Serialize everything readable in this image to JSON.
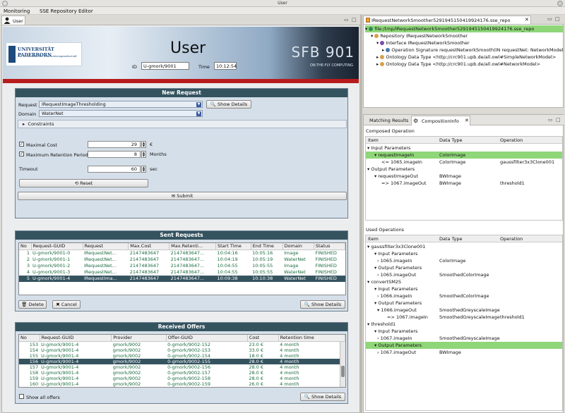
{
  "window": {
    "title": "User"
  },
  "menubar": {
    "items": [
      "Monitoring",
      "SSE Repository Editor"
    ]
  },
  "left_tab": {
    "label": "User"
  },
  "header": {
    "university": "UNIVERSITÄT PADERBORN",
    "university_sub": "Die Universität der Informationsgesellschaft",
    "title": "User",
    "id_label": "ID",
    "id_value": "U-gmork/9001",
    "time_label": "Time",
    "time_value": "10:12:54",
    "sfb": "SFB 901",
    "sfb_sub": "ON-THE-FLY COMPUTING"
  },
  "new_request": {
    "title": "New Request",
    "request_label": "Request",
    "request_value": "IRequestImageThresholding",
    "show_details": "Show Details",
    "domain_label": "Domain",
    "domain_value": "WaterNet",
    "constraints_label": "Constraints",
    "maximal_cost_label": "Maximal Cost",
    "maximal_cost_value": "29",
    "maximal_cost_unit": "€",
    "retention_label": "Maximum Retention Period",
    "retention_value": "8",
    "retention_unit": "Months",
    "timeout_label": "Timeout",
    "timeout_value": "60",
    "timeout_unit": "sec",
    "reset_label": "Reset",
    "submit_label": "Submit"
  },
  "sent_requests": {
    "title": "Sent Requests",
    "columns": [
      "No",
      "Request-GUID",
      "Request",
      "Max.Cost",
      "Max.Retenti...",
      "Start Time",
      "End Time",
      "Domain",
      "Status"
    ],
    "rows": [
      [
        "1",
        "U-gmork/9001-0",
        "IRequestNet...",
        "2147483647",
        "2147483647...",
        "10:04:16",
        "10:05:16",
        "Image",
        "FINISHED"
      ],
      [
        "2",
        "U-gmork/9001-1",
        "IRequestNet...",
        "2147483647",
        "2147483647...",
        "10:04:19",
        "10:05:19",
        "WaterNet",
        "FINISHED"
      ],
      [
        "3",
        "U-gmork/9001-2",
        "IRequestNet...",
        "2147483647",
        "2147483647...",
        "10:04:55",
        "10:05:55",
        "Image",
        "FINISHED"
      ],
      [
        "4",
        "U-gmork/9001-3",
        "IRequestNet...",
        "2147483647",
        "2147483647...",
        "10:04:55",
        "10:05:55",
        "WaterNet",
        "FINISHED"
      ],
      [
        "5",
        "U-gmork/9001-4",
        "IRequestIma...",
        "2147483647",
        "2147483647...",
        "10:09:38",
        "10:10:38",
        "WaterNet",
        "FINISHED"
      ]
    ],
    "delete_label": "Delete",
    "cancel_label": "Cancel",
    "show_details": "Show Details"
  },
  "received_offers": {
    "title": "Received Offers",
    "columns": [
      "No",
      "Request-GUID",
      "Provider",
      "Offer-GUID",
      "Cost",
      "Retention time"
    ],
    "rows": [
      [
        "153",
        "U-gmork/9001-4",
        "gmork/9002",
        "0-gmork/9002-152",
        "23.0 €",
        "4 month"
      ],
      [
        "154",
        "U-gmork/9001-4",
        "gmork/9002",
        "0-gmork/9002-153",
        "33.0 €",
        "4 month"
      ],
      [
        "155",
        "U-gmork/9001-4",
        "gmork/9002",
        "0-gmork/9002-154",
        "18.0 €",
        "4 month"
      ],
      [
        "156",
        "U-gmork/9001-4",
        "gmork/9002",
        "0-gmork/9002-155",
        "28.0 €",
        "4 month"
      ],
      [
        "157",
        "U-gmork/9001-4",
        "gmork/9002",
        "0-gmork/9002-156",
        "28.0 €",
        "4 month"
      ],
      [
        "158",
        "U-gmork/9001-4",
        "gmork/9002",
        "0-gmork/9002-157",
        "28.0 €",
        "4 month"
      ],
      [
        "159",
        "U-gmork/9001-4",
        "gmork/9002",
        "0-gmork/9002-158",
        "28.0 €",
        "4 month"
      ],
      [
        "160",
        "U-gmork/9001-4",
        "gmork/9002",
        "0-gmork/9002-159",
        "26.0 €",
        "4 month"
      ]
    ],
    "show_all_label": "Show all offers",
    "show_details": "Show Details"
  },
  "repo_editor": {
    "tab_label": "IRequestNetworkSmoother5291945150419924176.sse_repo",
    "tree": [
      "file:/tmp/IRequestNetworkSmoother5291945150419924176.sse_repo",
      "Repository IRequestNetworkSmoother",
      "Interface IRequestNetworkSmoother",
      "Operation Signature requestNetworkSmooth(IN requestNet: NetworkModel, O",
      "Ontology Data Type <http://crc901.upb.de/all.owl#SimpleNetworkModel>",
      "Ontology Data Type <http://crc901.upb.de/all.owl#NetworkModel>"
    ]
  },
  "composition": {
    "tab1": "Matching Results",
    "tab2": "CompositionInfo",
    "composed_label": "Composed Operation",
    "columns": [
      "Item",
      "Data Type",
      "Operation"
    ],
    "composed_rows": [
      [
        "Input Parameters",
        "",
        ""
      ],
      [
        "requestImageIn",
        "ColorImage",
        ""
      ],
      [
        "<= 1065.imageIn",
        "ColorImage",
        "gaussfilter3x3Clone001"
      ],
      [
        "Output Parameters",
        "",
        ""
      ],
      [
        "requestImageOut",
        "BWImage",
        ""
      ],
      [
        "=> 1067.imageOut",
        "BWImage",
        "threshold1"
      ]
    ],
    "used_label": "Used Operations",
    "used_rows": [
      [
        "gaussfilter3x3Clone001",
        "",
        ""
      ],
      [
        "Input Parameters",
        "",
        ""
      ],
      [
        "1065.imageIn",
        "ColorImage",
        ""
      ],
      [
        "Output Parameters",
        "",
        ""
      ],
      [
        "1065.imageOut",
        "SmoothedColorImage",
        ""
      ],
      [
        "convertSM2S",
        "",
        ""
      ],
      [
        "Input Parameters",
        "",
        ""
      ],
      [
        "1066.imageIn",
        "SmoothedColorImage",
        ""
      ],
      [
        "Output Parameters",
        "",
        ""
      ],
      [
        "1066.imageOut",
        "SmoothedGreyscaleImage",
        ""
      ],
      [
        "=> 1067.imageIn",
        "SmoothedGreyscaleImage",
        "threshold1"
      ],
      [
        "threshold1",
        "",
        ""
      ],
      [
        "Input Parameters",
        "",
        ""
      ],
      [
        "1067.imageIn",
        "SmoothedGreyscaleImage",
        ""
      ],
      [
        "Output Parameters",
        "",
        ""
      ],
      [
        "1067.imageOut",
        "BWImage",
        ""
      ]
    ]
  }
}
